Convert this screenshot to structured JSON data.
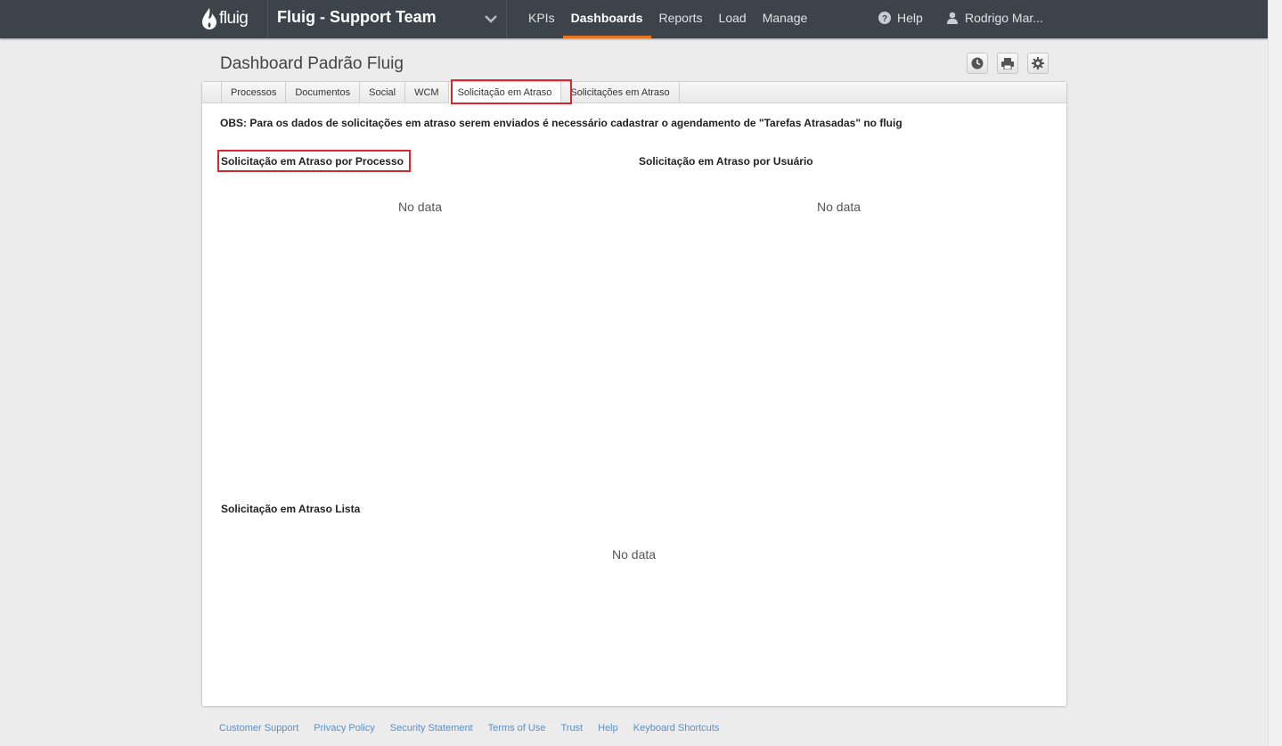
{
  "brand": {
    "logo_text": "fluig",
    "team_name": "Fluig - Support Team"
  },
  "nav": {
    "items": [
      {
        "label": "KPIs"
      },
      {
        "label": "Dashboards",
        "active": true
      },
      {
        "label": "Reports"
      },
      {
        "label": "Load"
      },
      {
        "label": "Manage"
      }
    ],
    "help": "Help",
    "user": "Rodrigo Mar..."
  },
  "page": {
    "title": "Dashboard Padrão Fluig",
    "tools": [
      "clock-icon",
      "print-icon",
      "gear-icon"
    ]
  },
  "tabs": [
    {
      "label": "Processos"
    },
    {
      "label": "Documentos"
    },
    {
      "label": "Social"
    },
    {
      "label": "WCM"
    },
    {
      "label": "Solicitação em Atraso",
      "active": true
    },
    {
      "label": "Solicitações em Atraso"
    }
  ],
  "content": {
    "obs": "OBS: Para os dados de solicitações em atraso serem enviados é necessário cadastrar o agendamento de \"Tarefas Atrasadas\" no fluig",
    "section_process": "Solicitação em Atraso por Processo",
    "section_user": "Solicitação em Atraso por Usuário",
    "section_list": "Solicitação em Atraso Lista",
    "no_data": "No data"
  },
  "footer": {
    "links": [
      "Customer Support",
      "Privacy Policy",
      "Security Statement",
      "Terms of Use",
      "Trust",
      "Help",
      "Keyboard Shortcuts"
    ]
  },
  "colors": {
    "topbar": "#3c434a",
    "accent": "#e8731f",
    "highlight": "#d7262e",
    "link": "#5c8fc2"
  }
}
